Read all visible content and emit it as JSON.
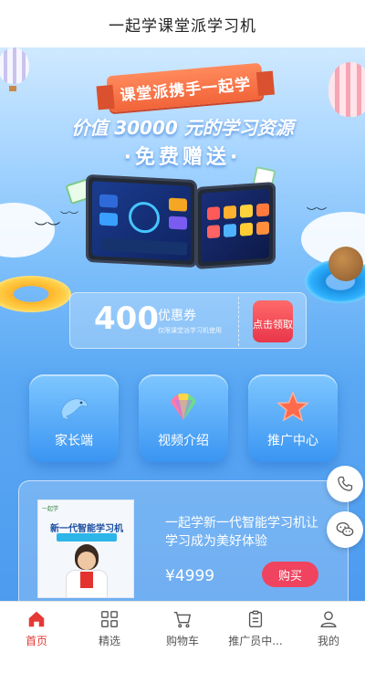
{
  "header": {
    "title": "一起学课堂派学习机"
  },
  "hero": {
    "ribbon_text": "课堂派携手一起学",
    "headline": "价值 30000 元的学习资源",
    "subline": "·免费赠送·"
  },
  "coupon": {
    "amount": "400",
    "unit": "优惠券",
    "note": "仅限课堂派学习机使用",
    "claim_label": "点击领取"
  },
  "features": [
    {
      "label": "家长端",
      "icon": "dolphin-icon"
    },
    {
      "label": "视频介绍",
      "icon": "fan-icon"
    },
    {
      "label": "推广中心",
      "icon": "star-icon"
    }
  ],
  "product": {
    "thumb_brand": "一起学",
    "thumb_title": "新一代智能学习机",
    "name": "一起学新一代智能学习机让学习成为美好体验",
    "price": "¥4999",
    "buy_label": "购买"
  },
  "float_buttons": [
    "phone-icon",
    "wechat-icon"
  ],
  "tabbar": {
    "active_index": 0,
    "accent_color": "#e53935",
    "items": [
      {
        "label": "首页",
        "icon": "home-icon"
      },
      {
        "label": "精选",
        "icon": "grid-icon"
      },
      {
        "label": "购物车",
        "icon": "cart-icon"
      },
      {
        "label": "推广员中...",
        "icon": "clipboard-icon"
      },
      {
        "label": "我的",
        "icon": "user-icon"
      }
    ]
  }
}
